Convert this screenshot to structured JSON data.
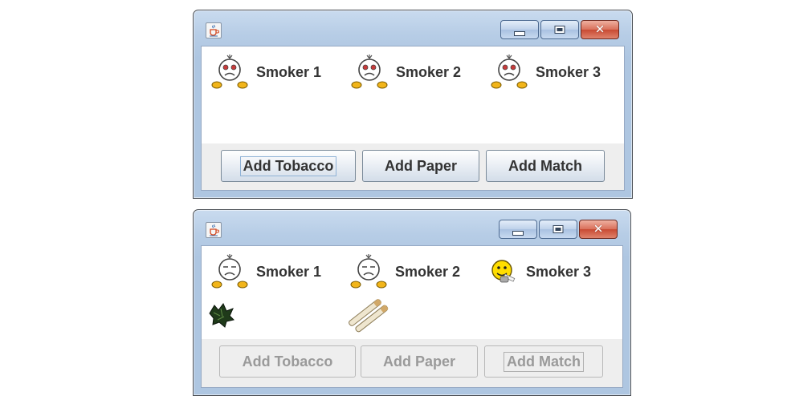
{
  "windows": [
    {
      "smokers": [
        {
          "label": "Smoker 1",
          "state": "waiting"
        },
        {
          "label": "Smoker 2",
          "state": "waiting"
        },
        {
          "label": "Smoker 3",
          "state": "waiting"
        }
      ],
      "items_on_table": [],
      "buttons": [
        {
          "label": "Add Tobacco",
          "enabled": true,
          "focused": true
        },
        {
          "label": "Add Paper",
          "enabled": true,
          "focused": false
        },
        {
          "label": "Add Match",
          "enabled": true,
          "focused": false
        }
      ]
    },
    {
      "smokers": [
        {
          "label": "Smoker 1",
          "state": "waiting"
        },
        {
          "label": "Smoker 2",
          "state": "waiting"
        },
        {
          "label": "Smoker 3",
          "state": "smoking"
        }
      ],
      "items_on_table": [
        "tobacco-icon",
        "paper-icon"
      ],
      "buttons": [
        {
          "label": "Add Tobacco",
          "enabled": false,
          "focused": false
        },
        {
          "label": "Add Paper",
          "enabled": false,
          "focused": false
        },
        {
          "label": "Add Match",
          "enabled": false,
          "focused": true
        }
      ]
    }
  ],
  "icons": {
    "app": "java-cup-icon",
    "minimize": "minimize-icon",
    "maximize": "maximize-icon",
    "close": "close-icon",
    "waiting_smoker": "sad-smoker-icon",
    "happy_smoker": "smoking-smiley-icon"
  },
  "colors": {
    "close_button": "#c84a33",
    "title_gradient": "#b7cde6",
    "smiley_yellow": "#ffdd00"
  }
}
